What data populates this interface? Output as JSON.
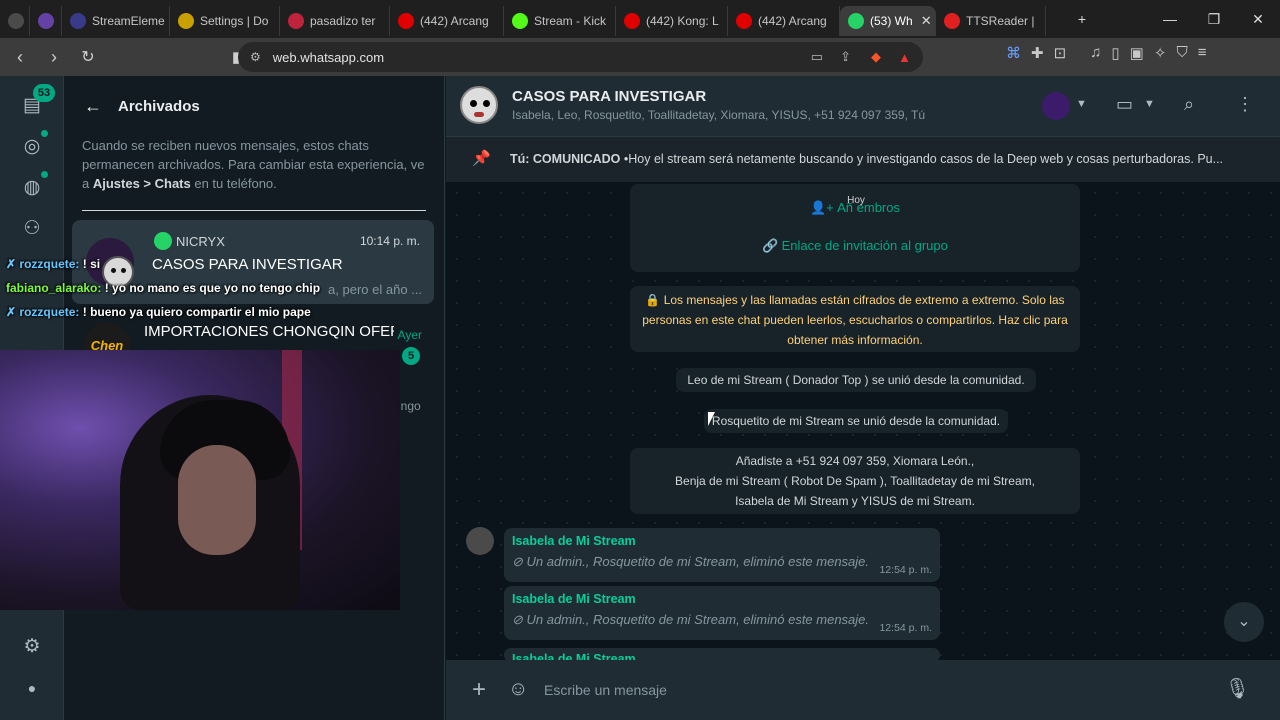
{
  "browser": {
    "tabs": [
      {
        "label": "",
        "icon": "diamond",
        "color": "#4a4a4a"
      },
      {
        "label": "",
        "icon": "twitch",
        "color": "#6441a5"
      },
      {
        "label": "StreamEleme",
        "icon": "streamelements",
        "color": "#3a3a8a"
      },
      {
        "label": "Settings | Do",
        "icon": "settings",
        "color": "#c8a000"
      },
      {
        "label": "pasadizo ter",
        "icon": "record",
        "color": "#c0233c"
      },
      {
        "label": "(442) Arcang",
        "icon": "youtube",
        "color": "#e00000"
      },
      {
        "label": "Stream - Kick",
        "icon": "kick",
        "color": "#53fc18"
      },
      {
        "label": "(442) Kong: L",
        "icon": "youtube",
        "color": "#e00000"
      },
      {
        "label": "(442) Arcang",
        "icon": "youtube",
        "color": "#e00000"
      },
      {
        "label": "(53) Wh",
        "icon": "whatsapp",
        "color": "#25d366"
      },
      {
        "label": "TTSReader | ",
        "icon": "ttsreader",
        "color": "#e02020"
      }
    ],
    "url": "web.whatsapp.com"
  },
  "rail": {
    "unread_count": "53"
  },
  "archived": {
    "title": "Archivados",
    "info_pre": "Cuando se reciben nuevos mensajes, estos chats permanecen archivados. Para cambiar esta experiencia, ve a ",
    "info_bold": "Ajustes > Chats",
    "info_post": " en tu teléfono."
  },
  "chats": [
    {
      "sender": "NICRYX",
      "name": "CASOS PARA INVESTIGAR",
      "time": "10:14 p. m.",
      "preview": "a, pero el año ..."
    },
    {
      "name": "IMPORTACIONES CHONGQIN OFER...",
      "time": "Ayer",
      "badge": "5",
      "avatar_text": "Chen"
    },
    {
      "preview_tail": "ingo"
    }
  ],
  "stream_chat": [
    {
      "user": "rozzquete:",
      "msg": " ! si"
    },
    {
      "user": "fabiano_alarako:",
      "msg": " ! yo no mano es que yo no tengo chip"
    },
    {
      "user": "rozzquete:",
      "msg": " ! bueno ya quiero compartir el mio pape"
    }
  ],
  "group": {
    "title": "CASOS PARA INVESTIGAR",
    "members": "Isabela, Leo, Rosquetito, Toallitadetay, Xiomara, YISUS, +51 924 097 359, Tú",
    "pinned_prefix": "Tú: COMUNICADO",
    "pinned_text": " •Hoy el stream será netamente buscando y investigando casos de la Deep web y cosas perturbadoras. Pu..."
  },
  "conversation": {
    "date_label": "Hoy",
    "add_members": "Añ          embros",
    "invite_link": "Enlace de invitación al grupo",
    "encryption": "🔒 Los mensajes y las llamadas están cifrados de extremo a extremo. Solo las personas en este chat pueden leerlos, escucharlos o compartirlos. Haz clic para obtener más información.",
    "sys1": "Leo de mi Stream ( Donador Top ) se unió desde la comunidad.",
    "sys2": "Rosquetito de mi Stream se unió desde la comunidad.",
    "sys3_l1": "Añadiste a +51 924 097 359, Xiomara León.,",
    "sys3_l2": "Benja de mi Stream ( Robot De Spam ), Toallitadetay de mi Stream,",
    "sys3_l3": "Isabela de Mi Stream y YISUS de mi Stream.",
    "messages": [
      {
        "sender": "Isabela de Mi Stream",
        "text": "Un admin., Rosquetito de mi Stream, eliminó este mensaje.",
        "time": "12:54 p. m."
      },
      {
        "sender": "Isabela de Mi Stream",
        "text": "Un admin., Rosquetito de mi Stream, eliminó este mensaje.",
        "time": "12:54 p. m."
      },
      {
        "sender": "Isabela de Mi Stream"
      }
    ]
  },
  "compose": {
    "placeholder": "Escribe un mensaje"
  }
}
